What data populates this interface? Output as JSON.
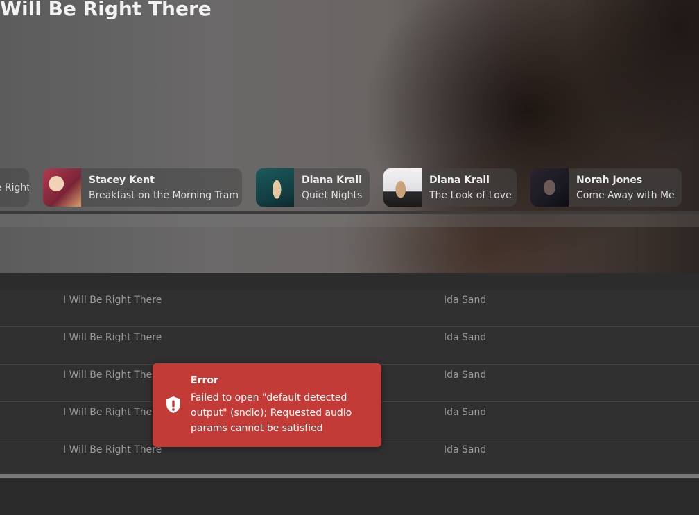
{
  "hero": {
    "title": "I Will Be Right There",
    "albums": [
      {
        "artist": "",
        "album": "I Will Be Right There",
        "colors": [
          "#6a6a6a",
          "#555555"
        ]
      },
      {
        "artist": "Stacey Kent",
        "album": "Breakfast on the Morning Tram",
        "colors": [
          "#b23a52",
          "#f0d2b6"
        ]
      },
      {
        "artist": "Diana Krall",
        "album": "Quiet Nights",
        "colors": [
          "#1a5a5c",
          "#e4c8a2"
        ]
      },
      {
        "artist": "Diana Krall",
        "album": "The Look of Love",
        "colors": [
          "#e8e8ea",
          "#caa278"
        ]
      },
      {
        "artist": "Norah Jones",
        "album": "Come Away with Me",
        "colors": [
          "#1a1a22",
          "#6b5a55"
        ]
      }
    ]
  },
  "tracks": [
    {
      "title": "I Will Be Right There",
      "artist": "Ida Sand"
    },
    {
      "title": "I Will Be Right There",
      "artist": "Ida Sand"
    },
    {
      "title": "I Will Be Right There",
      "artist": "Ida Sand"
    },
    {
      "title": "I Will Be Right There",
      "artist": "Ida Sand"
    },
    {
      "title": "I Will Be Right There",
      "artist": "Ida Sand"
    }
  ],
  "toast": {
    "title": "Error",
    "message": "Failed to open \"default detected output\" (sndio); Requested audio params cannot be satisfied",
    "icon": "shield-alert-icon",
    "color": "#c23b36"
  }
}
